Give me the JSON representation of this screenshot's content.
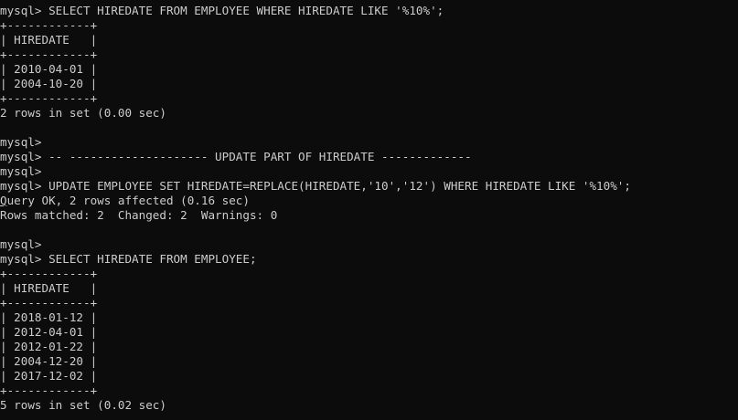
{
  "terminal": {
    "lines": [
      "mysql> SELECT HIREDATE FROM EMPLOYEE WHERE HIREDATE LIKE '%10%';",
      "+------------+",
      "| HIREDATE   |",
      "+------------+",
      "| 2010-04-01 |",
      "| 2004-10-20 |",
      "+------------+",
      "2 rows in set (0.00 sec)",
      "",
      "mysql>",
      "mysql> -- -------------------- UPDATE PART OF HIREDATE -------------",
      "mysql>",
      "mysql> UPDATE EMPLOYEE SET HIREDATE=REPLACE(HIREDATE,'10','12') WHERE HIREDATE LIKE '%10%';",
      "Query OK, 2 rows affected (0.16 sec)",
      "Rows matched: 2  Changed: 2  Warnings: 0",
      "",
      "mysql>",
      "mysql> SELECT HIREDATE FROM EMPLOYEE;",
      "+------------+",
      "| HIREDATE   |",
      "+------------+",
      "| 2018-01-12 |",
      "| 2012-04-01 |",
      "| 2012-01-22 |",
      "| 2004-12-20 |",
      "| 2017-12-02 |",
      "+------------+",
      "5 rows in set (0.02 sec)"
    ]
  },
  "colors": {
    "background": "#0c0c0c",
    "foreground": "#cccccc"
  }
}
